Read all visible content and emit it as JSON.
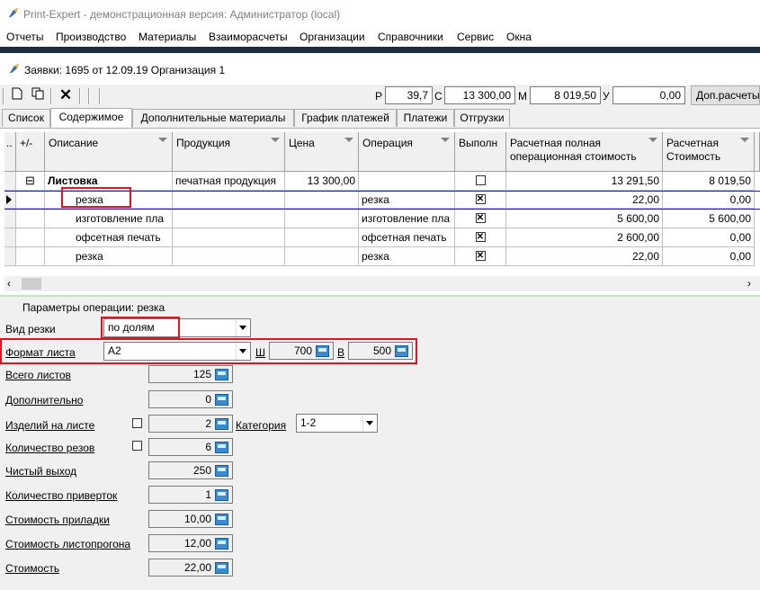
{
  "window": {
    "title": "Print-Expert - демонстрационная версия: Администратор (local)"
  },
  "menu": [
    "Отчеты",
    "Производство",
    "Материалы",
    "Взаиморасчеты",
    "Организации",
    "Справочники",
    "Сервис",
    "Окна"
  ],
  "document": {
    "title": "Заявки: 1695 от 12.09.19  Организация 1"
  },
  "toolbar": {
    "p_label": "Р",
    "p_value": "39,7",
    "c_label": "С",
    "c_value": "13 300,00",
    "m_label": "М",
    "m_value": "8 019,50",
    "u_label": "У",
    "u_value": "0,00",
    "extra_button": "Доп.расчеты"
  },
  "tabs": [
    "Список",
    "Содержимое",
    "Дополнительные материалы",
    "График платежей",
    "Платежи",
    "Отгрузки"
  ],
  "grid": {
    "headers": [
      "+/-",
      "Описание",
      "Продукция",
      "Цена",
      "Операция",
      "Выполн",
      "Расчетная полная операционная стоимость",
      "Расчетная Стоимость"
    ],
    "group": {
      "expander": "⊟",
      "description": "Листовка",
      "product": "печатная продукция",
      "price": "13 300,00",
      "full_cost": "13 291,50",
      "cost": "8 019,50"
    },
    "rows": [
      {
        "description": "резка",
        "operation": "резка",
        "done": "✕",
        "full_cost": "22,00",
        "cost": "0,00"
      },
      {
        "description": "изготовление пла",
        "operation": "изготовление пла",
        "done": "✕",
        "full_cost": "5 600,00",
        "cost": "5 600,00"
      },
      {
        "description": "офсетная печать",
        "operation": "офсетная печать",
        "done": "✕",
        "full_cost": "2 600,00",
        "cost": "0,00"
      },
      {
        "description": "резка",
        "operation": "резка",
        "done": "✕",
        "full_cost": "22,00",
        "cost": "0,00"
      }
    ]
  },
  "params": {
    "title": "Параметры операции: резка",
    "cut_type_label": "Вид резки",
    "cut_type_value": "по долям",
    "sheet_format_label": "Формат листа",
    "sheet_format_value": "A2",
    "width_label": "Ш",
    "width_value": "700",
    "height_label": "В",
    "height_value": "500",
    "fields": [
      {
        "label": "Всего листов",
        "value": "125"
      },
      {
        "label": "Дополнительно",
        "value": "0"
      },
      {
        "label": "Изделий на листе",
        "value": "2"
      },
      {
        "label": "Количество резов",
        "value": "6"
      },
      {
        "label": "Чистый выход",
        "value": "250"
      },
      {
        "label": "Количество приверток",
        "value": "1"
      },
      {
        "label": "Стоимость приладки",
        "value": "10,00"
      },
      {
        "label": "Стоимость листопрогона",
        "value": "12,00"
      },
      {
        "label": "Стоимость",
        "value": "22,00"
      }
    ],
    "category_label": "Категория",
    "category_value": "1-2"
  }
}
